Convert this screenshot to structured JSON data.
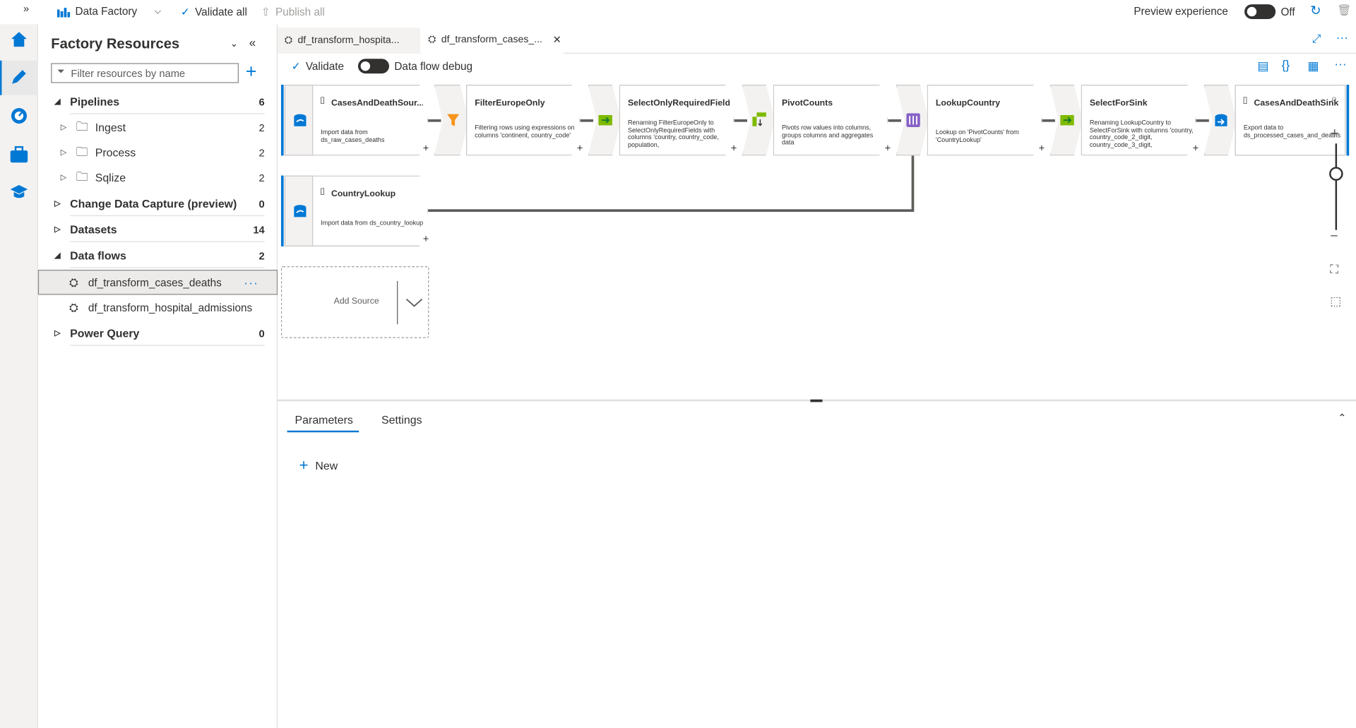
{
  "topbar": {
    "factory_label": "Data Factory",
    "validate_all": "Validate all",
    "publish_all": "Publish all",
    "preview_label": "Preview experience",
    "preview_state": "Off"
  },
  "panel": {
    "title": "Factory Resources",
    "filter_placeholder": "Filter resources by name",
    "pipelines": {
      "label": "Pipelines",
      "count": "6"
    },
    "folders": [
      {
        "label": "Ingest",
        "count": "2"
      },
      {
        "label": "Process",
        "count": "2"
      },
      {
        "label": "Sqlize",
        "count": "2"
      }
    ],
    "cdc": {
      "label": "Change Data Capture (preview)",
      "count": "0"
    },
    "datasets": {
      "label": "Datasets",
      "count": "14"
    },
    "dataflows": {
      "label": "Data flows",
      "count": "2"
    },
    "flows": [
      "df_transform_cases_deaths",
      "df_transform_hospital_admissions"
    ],
    "powerquery": {
      "label": "Power Query",
      "count": "0"
    }
  },
  "tabs": [
    "df_transform_hospita...",
    "df_transform_cases_..."
  ],
  "toolbar": {
    "validate": "Validate",
    "debug": "Data flow debug"
  },
  "nodes": [
    {
      "name": "CasesAndDeathSour...",
      "desc": "Import data from ds_raw_cases_deaths"
    },
    {
      "name": "FilterEuropeOnly",
      "desc": "Filtering rows using expressions on columns 'continent, country_code'"
    },
    {
      "name": "SelectOnlyRequiredFields",
      "desc": "Renaming FilterEuropeOnly to SelectOnlyRequiredFields with columns 'country, country_code, population,"
    },
    {
      "name": "PivotCounts",
      "desc": "Pivots row values into columns, groups columns and aggregates data"
    },
    {
      "name": "LookupCountry",
      "desc": "Lookup on 'PivotCounts' from 'CountryLookup'"
    },
    {
      "name": "SelectForSink",
      "desc": "Renaming LookupCountry to SelectForSink with columns 'country, country_code_2_digit, country_code_3_digit,"
    },
    {
      "name": "CasesAndDeathSink",
      "desc": "Export data to ds_processed_cases_and_deaths"
    },
    {
      "name": "CountryLookup",
      "desc": "Import data from ds_country_lookup"
    }
  ],
  "add_source": "Add Source",
  "bottom": {
    "tab_params": "Parameters",
    "tab_settings": "Settings",
    "new": "New"
  }
}
